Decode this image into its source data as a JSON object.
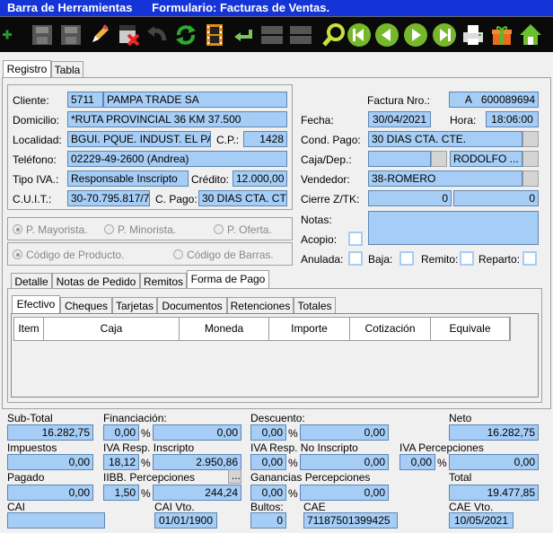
{
  "window": {
    "title": "Barra de Herramientas      Formulario: Facturas de Ventas."
  },
  "toolbar": {
    "buttons": [
      "add-icon",
      "save-icon",
      "save-as-icon",
      "edit-icon",
      "delete-icon",
      "undo-icon",
      "refresh-icon",
      "film-icon",
      "return-icon",
      "disabled-icon",
      "disabled-icon",
      "search-icon",
      "first-icon",
      "previous-icon",
      "next-icon",
      "last-icon",
      "print-icon",
      "gift-icon",
      "home-icon"
    ]
  },
  "main_tabs": [
    "Registro",
    "Tabla"
  ],
  "header": {
    "cliente_label": "Cliente:",
    "cliente_code": "5711",
    "cliente_name": "PAMPA TRADE SA",
    "domicilio_label": "Domicilio:",
    "domicilio": "*RUTA PROVINCIAL 36 KM 37.500",
    "localidad_label": "Localidad:",
    "localidad": "BGUI. PQUE. INDUST. EL PA",
    "cp_label": "C.P.:",
    "cp": "1428",
    "telefono_label": "Teléfono:",
    "telefono": "02229-49-2600 (Andrea)",
    "tipo_iva_label": "Tipo IVA.:",
    "tipo_iva": "Responsable Inscripto",
    "credito_label": "Crédito:",
    "credito": "12.000,00",
    "cuit_label": "C.U.I.T.:",
    "cuit": "30-70.795.817/7",
    "cpago_label": "C. Pago:",
    "cpago": "30 DIAS CTA. CT",
    "factura_label": "Factura Nro.:",
    "factura_tipo": "A",
    "factura_nro": "600089694",
    "fecha_label": "Fecha:",
    "fecha": "30/04/2021",
    "hora_label": "Hora:",
    "hora": "18:06:00",
    "cond_pago_label": "Cond. Pago:",
    "cond_pago": "30 DIAS CTA. CTE.",
    "caja_label": "Caja/Dep.:",
    "caja_dep": "RODOLFO ...",
    "vendedor_label": "Vendedor:",
    "vendedor": "38-ROMERO",
    "cierre_label": "Cierre Z/TK:",
    "cierre_1": "0",
    "cierre_2": "0",
    "notas_label": "Notas:",
    "acopio_label": "Acopio:",
    "anulada_label": "Anulada:",
    "baja_label": "Baja:",
    "remito_label": "Remito:",
    "reparto_label": "Reparto:"
  },
  "price_radios": [
    "P. Mayorista.",
    "P. Minorista.",
    "P. Oferta."
  ],
  "code_radios": [
    "Código de Producto.",
    "Código de Barras."
  ],
  "detail_tabs": [
    "Detalle",
    "Notas de Pedido",
    "Remitos",
    "Forma de Pago"
  ],
  "payment_tabs": [
    "Efectivo",
    "Cheques",
    "Tarjetas",
    "Documentos",
    "Retenciones",
    "Totales"
  ],
  "grid_columns": [
    "Item",
    "Caja",
    "Moneda",
    "Importe",
    "Cotización",
    "Equivale"
  ],
  "totals": {
    "subtotal_label": "Sub-Total",
    "subtotal": "16.282,75",
    "financiacion_label": "Financiación:",
    "financiacion_pct": "0,00",
    "financiacion": "0,00",
    "descuento_label": "Descuento:",
    "descuento_pct": "0,00",
    "descuento": "0,00",
    "neto_label": "Neto",
    "neto": "16.282,75",
    "impuestos_label": "Impuestos",
    "impuestos": "0,00",
    "iva_ri_label": "IVA Resp. Inscripto",
    "iva_ri_pct": "18,12",
    "iva_ri": "2.950,86",
    "iva_rni_label": "IVA Resp. No Inscripto",
    "iva_rni_pct": "0,00",
    "iva_rni": "0,00",
    "iva_perc_label": "IVA Percepciones",
    "iva_perc_pct": "0,00",
    "iva_perc": "0,00",
    "pagado_label": "Pagado",
    "pagado": "0,00",
    "iibb_label": "IIBB. Percepciones",
    "iibb_pct": "1,50",
    "iibb": "244,24",
    "ganancias_label": "Ganancias Percepciones",
    "ganancias_pct": "0,00",
    "ganancias": "0,00",
    "total_label": "Total",
    "total": "19.477,85",
    "cai_label": "CAI",
    "cai": "",
    "cai_vto_label": "CAI Vto.",
    "cai_vto": "01/01/1900",
    "bultos_label": "Bultos:",
    "bultos": "0",
    "cae_label": "CAE",
    "cae": "71187501399425",
    "cae_vto_label": "CAE Vto.",
    "cae_vto": "10/05/2021",
    "pct": "%",
    "ellipsis": "..."
  },
  "colors": {
    "field": "#a6cdf5",
    "titlebar": "#1434d8",
    "toolbar": "#0a0a0a"
  }
}
